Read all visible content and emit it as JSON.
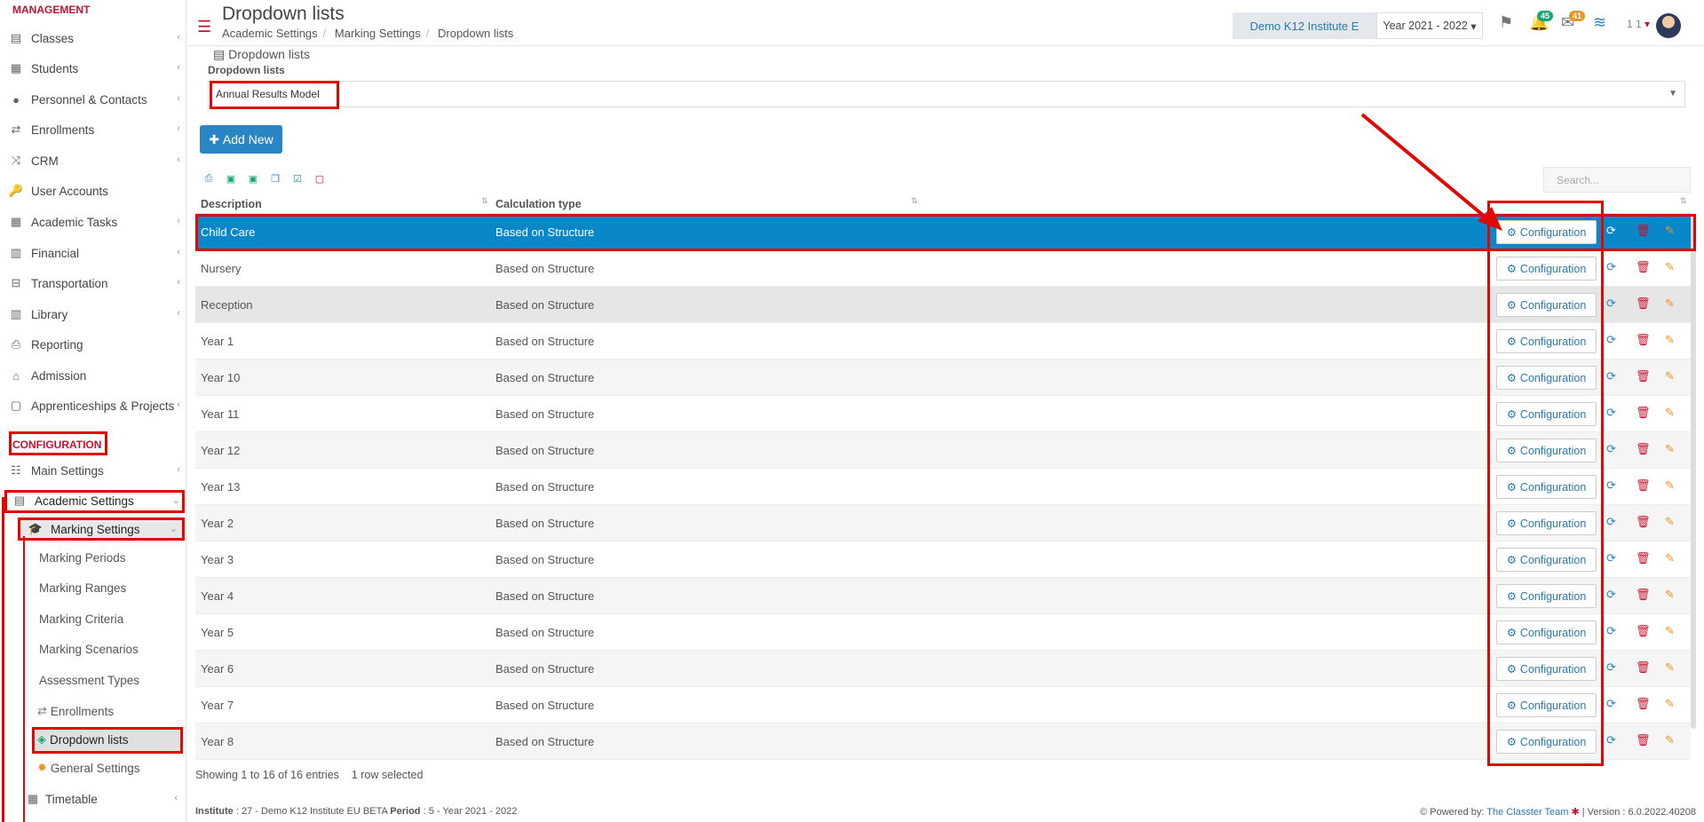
{
  "sidebar": {
    "management_label": "MANAGEMENT",
    "configuration_label": "CONFIGURATION",
    "items": [
      {
        "label": "Classes",
        "icon": "classes-icon"
      },
      {
        "label": "Students",
        "icon": "students-icon"
      },
      {
        "label": "Personnel & Contacts",
        "icon": "personnel-icon"
      },
      {
        "label": "Enrollments",
        "icon": "enrollments-icon"
      },
      {
        "label": "CRM",
        "icon": "crm-icon"
      },
      {
        "label": "User Accounts",
        "icon": "key-icon"
      },
      {
        "label": "Academic Tasks",
        "icon": "tasks-icon"
      },
      {
        "label": "Financial",
        "icon": "financial-icon"
      },
      {
        "label": "Transportation",
        "icon": "bus-icon"
      },
      {
        "label": "Library",
        "icon": "library-icon"
      },
      {
        "label": "Reporting",
        "icon": "print-icon"
      },
      {
        "label": "Admission",
        "icon": "admission-icon"
      },
      {
        "label": "Apprenticeships & Projects",
        "icon": "box-icon"
      }
    ],
    "config_items": [
      {
        "label": "Main Settings",
        "icon": "sliders-icon"
      },
      {
        "label": "Academic Settings",
        "icon": "classes-icon"
      }
    ],
    "marking_settings": "Marking Settings",
    "sub_items": [
      "Marking Periods",
      "Marking Ranges",
      "Marking Criteria",
      "Marking Scenarios",
      "Assessment Types",
      "Enrollments",
      "Dropdown lists",
      "General Settings"
    ],
    "timetable": "Timetable"
  },
  "topbar": {
    "title": "Dropdown lists",
    "breadcrumbs": [
      "Academic Settings",
      "Marking Settings",
      "Dropdown lists"
    ],
    "institute": "Demo K12 Institute E",
    "year": "Year 2021 - 2022",
    "notifications_count": "45",
    "messages_count": "41",
    "user_number": "1 1"
  },
  "main": {
    "panel_title": "Dropdown lists",
    "field_label": "Dropdown lists",
    "select_value": "Annual Results Model",
    "add_button": "Add New",
    "search_placeholder": "Search...",
    "columns": [
      "Description",
      "Calculation type"
    ],
    "config_label": "Configuration",
    "rows": [
      {
        "description": "Child Care",
        "calc": "Based on Structure"
      },
      {
        "description": "Nursery",
        "calc": "Based on Structure"
      },
      {
        "description": "Reception",
        "calc": "Based on Structure"
      },
      {
        "description": "Year 1",
        "calc": "Based on Structure"
      },
      {
        "description": "Year 10",
        "calc": "Based on Structure"
      },
      {
        "description": "Year 11",
        "calc": "Based on Structure"
      },
      {
        "description": "Year 12",
        "calc": "Based on Structure"
      },
      {
        "description": "Year 13",
        "calc": "Based on Structure"
      },
      {
        "description": "Year 2",
        "calc": "Based on Structure"
      },
      {
        "description": "Year 3",
        "calc": "Based on Structure"
      },
      {
        "description": "Year 4",
        "calc": "Based on Structure"
      },
      {
        "description": "Year 5",
        "calc": "Based on Structure"
      },
      {
        "description": "Year 6",
        "calc": "Based on Structure"
      },
      {
        "description": "Year 7",
        "calc": "Based on Structure"
      },
      {
        "description": "Year 8",
        "calc": "Based on Structure"
      }
    ],
    "info": "Showing 1 to 16 of 16 entries",
    "selected_info": "1 row selected"
  },
  "footer": {
    "institute_label": "Institute",
    "institute_value": ": 27 - Demo K12 Institute EU BETA",
    "period_label": "Period",
    "period_value": ": 5 - Year 2021 - 2022",
    "powered_by": "Powered by:",
    "team": "The Classter Team",
    "version": "| Version : 6.0.2022.40208"
  },
  "colors": {
    "accent": "#c8102e",
    "selected_row": "#0a87c9",
    "primary": "#2a85c5"
  }
}
